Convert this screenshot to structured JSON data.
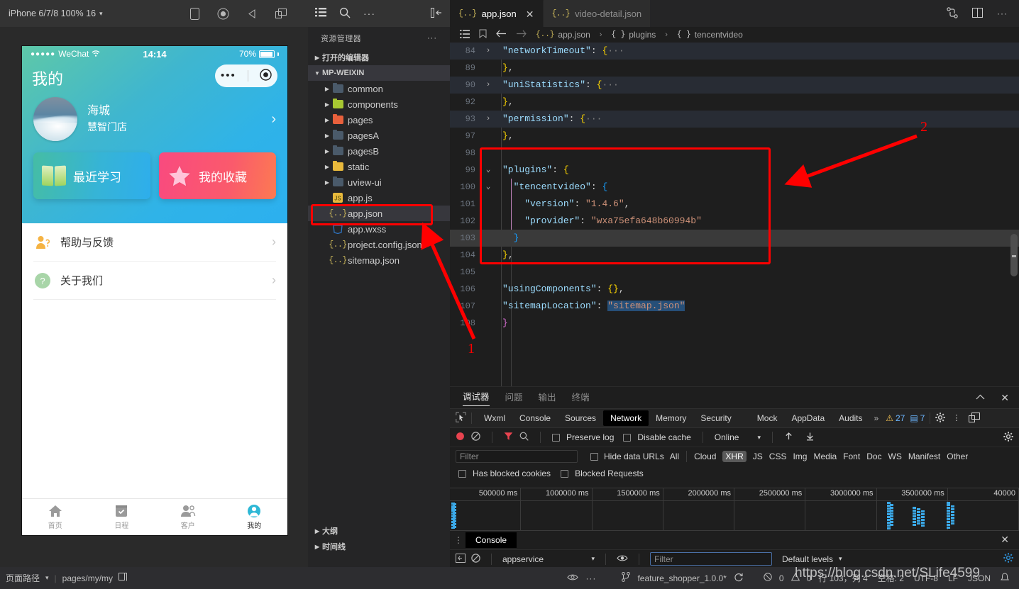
{
  "simulator": {
    "device_label": "iPhone 6/7/8 100% 16",
    "caret": "▾",
    "tools": [
      "rotate-device-icon",
      "record-icon",
      "sound-icon",
      "separate-window-icon"
    ],
    "phone": {
      "status": {
        "carrier": "WeChat",
        "signal_dots": "●●●●●",
        "time": "14:14",
        "battery_pct": "70%"
      },
      "nav_title": "我的",
      "profile": {
        "name": "海城",
        "store": "慧智门店"
      },
      "cards": [
        {
          "label": "最近学习",
          "icon": "book-icon"
        },
        {
          "label": "我的收藏",
          "icon": "star-icon"
        }
      ],
      "rows": [
        {
          "label": "帮助与反馈",
          "icon": "help-person-icon"
        },
        {
          "label": "关于我们",
          "icon": "question-icon"
        }
      ],
      "tabbar": [
        {
          "label": "首页",
          "icon": "home-icon",
          "active": false
        },
        {
          "label": "日程",
          "icon": "calendar-icon",
          "active": false
        },
        {
          "label": "客户",
          "icon": "customer-icon",
          "active": false
        },
        {
          "label": "我的",
          "icon": "profile-icon",
          "active": true
        }
      ]
    }
  },
  "explorer": {
    "title": "资源管理器",
    "title_dots": "···",
    "sections": [
      {
        "label": "打开的编辑器",
        "expanded": false
      },
      {
        "label": "MP-WEIXIN",
        "expanded": true
      }
    ],
    "files": [
      {
        "name": "common",
        "type": "folder",
        "color": "#4a5a6a",
        "expandable": true
      },
      {
        "name": "components",
        "type": "folder",
        "color": "#a8c832",
        "expandable": true
      },
      {
        "name": "pages",
        "type": "folder",
        "color": "#e8603c",
        "expandable": true
      },
      {
        "name": "pagesA",
        "type": "folder",
        "color": "#4a5a6a",
        "expandable": true
      },
      {
        "name": "pagesB",
        "type": "folder",
        "color": "#4a5a6a",
        "expandable": true
      },
      {
        "name": "static",
        "type": "folder",
        "color": "#e8b93c",
        "expandable": true
      },
      {
        "name": "uview-ui",
        "type": "folder",
        "color": "#4a5a6a",
        "expandable": true
      },
      {
        "name": "app.js",
        "type": "js",
        "expandable": false
      },
      {
        "name": "app.json",
        "type": "json",
        "expandable": false,
        "selected": true
      },
      {
        "name": "app.wxss",
        "type": "wxss",
        "expandable": false
      },
      {
        "name": "project.config.json",
        "type": "json",
        "expandable": false
      },
      {
        "name": "sitemap.json",
        "type": "json",
        "expandable": false
      }
    ],
    "bottom_sections": [
      "大纲",
      "时间线"
    ]
  },
  "editor": {
    "tabs": [
      {
        "label": "app.json",
        "active": true,
        "closeable": true
      },
      {
        "label": "video-detail.json",
        "active": false,
        "closeable": false
      }
    ],
    "breadcrumb": [
      "app.json",
      "plugins",
      "tencentvideo"
    ],
    "lines": [
      {
        "no": "84",
        "fold": "›",
        "html": "<span class=\"k\">\"networkTimeout\"</span><span class=\"p\">: </span><span class=\"br2\">{</span><span class=\"dim\">···</span>",
        "state": "hl"
      },
      {
        "no": "89",
        "fold": "",
        "html": "<span class=\"br2\">}</span><span class=\"p\">,</span>",
        "state": ""
      },
      {
        "no": "90",
        "fold": "›",
        "html": "<span class=\"k\">\"uniStatistics\"</span><span class=\"p\">: </span><span class=\"br2\">{</span><span class=\"dim\">···</span>",
        "state": "hl"
      },
      {
        "no": "92",
        "fold": "",
        "html": "<span class=\"br2\">}</span><span class=\"p\">,</span>",
        "state": ""
      },
      {
        "no": "93",
        "fold": "›",
        "html": "<span class=\"k\">\"permission\"</span><span class=\"p\">: </span><span class=\"br2\">{</span><span class=\"dim\">···</span>",
        "state": "hl"
      },
      {
        "no": "97",
        "fold": "",
        "html": "<span class=\"br2\">}</span><span class=\"p\">,</span>",
        "state": ""
      },
      {
        "no": "98",
        "fold": "",
        "html": "",
        "state": ""
      },
      {
        "no": "99",
        "fold": "⌄",
        "html": "<span class=\"k\">\"plugins\"</span><span class=\"p\">: </span><span class=\"br2\">{</span>",
        "state": ""
      },
      {
        "no": "100",
        "fold": "⌄",
        "html": "  <span class=\"k\">\"tencentvideo\"</span><span class=\"p\">: </span><span class=\"br3\">{</span>",
        "state": ""
      },
      {
        "no": "101",
        "fold": "",
        "html": "    <span class=\"k\">\"version\"</span><span class=\"p\">: </span><span class=\"s\">\"1.4.6\"</span><span class=\"p\">,</span>",
        "state": ""
      },
      {
        "no": "102",
        "fold": "",
        "html": "    <span class=\"k\">\"provider\"</span><span class=\"p\">: </span><span class=\"s\">\"wxa75efa648b60994b\"</span>",
        "state": ""
      },
      {
        "no": "103",
        "fold": "",
        "html": "  <span class=\"br3\">}</span>",
        "state": "cur"
      },
      {
        "no": "104",
        "fold": "",
        "html": "<span class=\"br2\">}</span><span class=\"p\">,</span>",
        "state": ""
      },
      {
        "no": "105",
        "fold": "",
        "html": "",
        "state": ""
      },
      {
        "no": "106",
        "fold": "",
        "html": "<span class=\"k\">\"usingComponents\"</span><span class=\"p\">: </span><span class=\"br2\">{}</span><span class=\"p\">,</span>",
        "state": ""
      },
      {
        "no": "107",
        "fold": "",
        "html": "<span class=\"k\">\"sitemapLocation\"</span><span class=\"p\">: </span><span class=\"s sel\">\"sitemap.json\"</span>",
        "state": ""
      },
      {
        "no": "108",
        "fold": "",
        "html": "<span class=\"br\">}</span>",
        "state": ""
      }
    ]
  },
  "devtools": {
    "panel_tabs": [
      {
        "label": "调试器",
        "active": true
      },
      {
        "label": "问题",
        "active": false
      },
      {
        "label": "输出",
        "active": false
      },
      {
        "label": "终端",
        "active": false
      }
    ],
    "dt_tabs": [
      "Wxml",
      "Console",
      "Sources",
      "Network",
      "Memory",
      "Security",
      "Mock",
      "AppData",
      "Audits"
    ],
    "dt_active": "Network",
    "dt_overflow": "»",
    "warning_count": "27",
    "message_count": "7",
    "network_toolbar": {
      "preserve_log": "Preserve log",
      "disable_cache": "Disable cache",
      "throttle": "Online",
      "throttle_caret": "▾"
    },
    "filter": {
      "placeholder": "Filter",
      "hide_data_urls": "Hide data URLs",
      "types": [
        "All",
        "Cloud",
        "XHR",
        "JS",
        "CSS",
        "Img",
        "Media",
        "Font",
        "Doc",
        "WS",
        "Manifest",
        "Other"
      ],
      "active_type": "XHR",
      "has_blocked_cookies": "Has blocked cookies",
      "blocked_requests": "Blocked Requests"
    },
    "timeline": {
      "ticks": [
        "500000 ms",
        "1000000 ms",
        "1500000 ms",
        "2000000 ms",
        "2500000 ms",
        "3000000 ms",
        "3500000 ms",
        "40000"
      ]
    }
  },
  "console_drawer": {
    "tab": "Console",
    "context": "appservice",
    "context_caret": "▾",
    "filter_placeholder": "Filter",
    "levels": "Default levels",
    "levels_caret": "▾"
  },
  "status_bar": {
    "page_path_label": "页面路径",
    "page_path_caret": "▾",
    "page_path": "pages/my/my",
    "branch": "feature_shopper_1.0.0*",
    "errors": "0",
    "warnings": "0",
    "cursor": "行 103，列 4",
    "selection": "空格: 2",
    "encoding": "UTF-8",
    "eol": "LF",
    "language": "JSON",
    "watermark": "https://blog.csdn.net/SLife4599"
  },
  "annotations": [
    {
      "label": "1",
      "type": "arrow-callout"
    },
    {
      "label": "2",
      "type": "arrow-callout"
    }
  ],
  "colors": {
    "accent_red": "#ff0000",
    "editor_bg": "#1e1e1e",
    "sidebar_bg": "#252526",
    "status_bg": "#2d2d30"
  }
}
